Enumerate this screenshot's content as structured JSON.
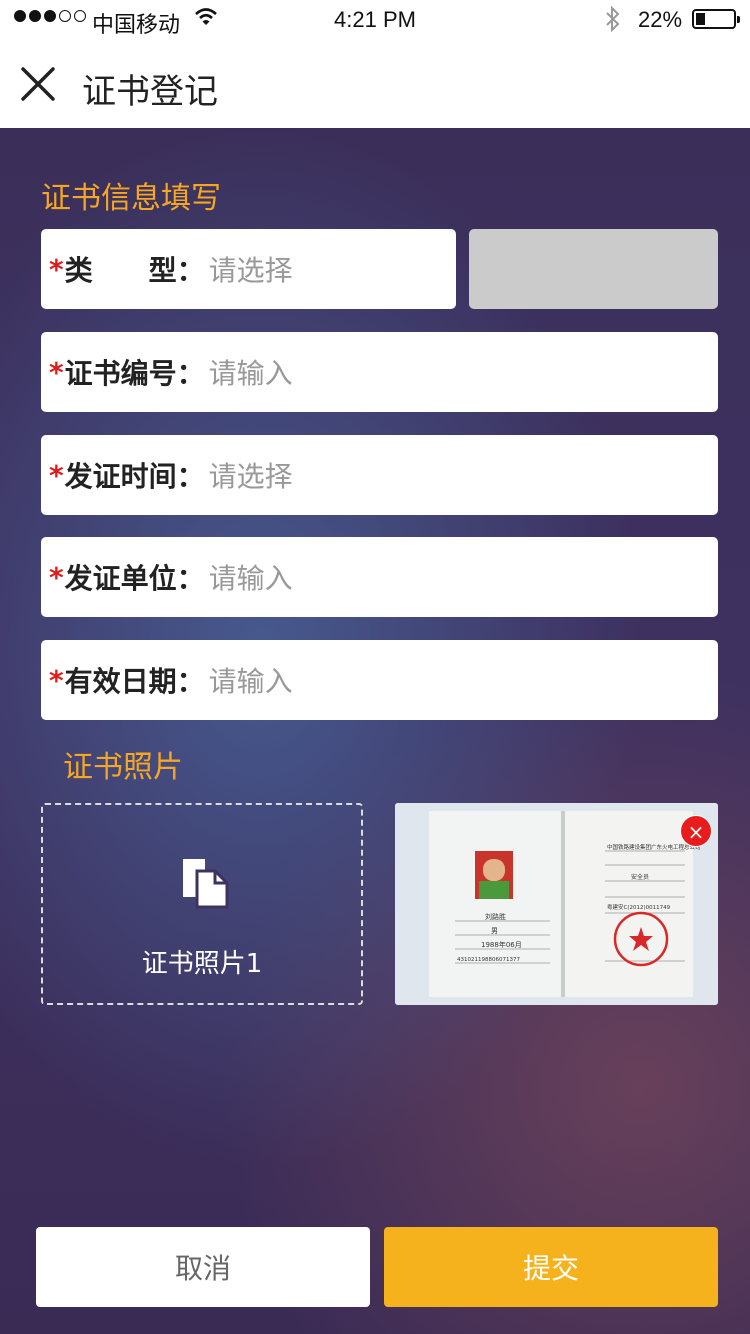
{
  "status_bar": {
    "carrier": "中国移动",
    "time": "4:21 PM",
    "battery": "22%",
    "battery_level": 0.22,
    "signal_bars": 3,
    "signal_total": 5
  },
  "nav": {
    "title": "证书登记",
    "close_icon": "close-icon"
  },
  "form": {
    "section_title": "证书信息填写",
    "required_mark": "*",
    "fields": [
      {
        "label": "类　　型：",
        "value": "请选择"
      },
      {
        "label": "证书编号：",
        "value": "请输入"
      },
      {
        "label": "发证时间：",
        "value": "请选择"
      },
      {
        "label": "发证单位：",
        "value": "请输入"
      },
      {
        "label": "有效日期：",
        "value": "请输入"
      }
    ]
  },
  "photos": {
    "section_title": "证书照片",
    "upload_label": "证书照片1",
    "upload_icon": "document-icon",
    "remove_symbol": "×",
    "certificate": {
      "name": "刘路胜",
      "gender": "男",
      "birth": "1988年06月",
      "id_number": "431021198806071377",
      "company": "中国铁路建设集团广东火电工程总公司",
      "position": "安全员",
      "cert_no": "粤建安C(2012)0011749"
    }
  },
  "actions": {
    "cancel": "取消",
    "submit": "提交"
  },
  "colors": {
    "accent": "#f5a623",
    "submit_bg": "#f6b21c",
    "required": "#e01b1b",
    "background": "#3b2f5a"
  }
}
